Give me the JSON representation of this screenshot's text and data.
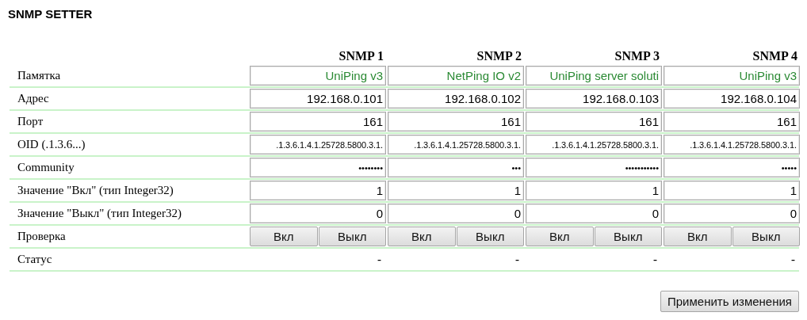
{
  "title": "SNMP SETTER",
  "columns": [
    "SNMP 1",
    "SNMP 2",
    "SNMP 3",
    "SNMP 4"
  ],
  "rows": [
    {
      "label": "Памятка",
      "kind": "memo",
      "values": [
        "UniPing v3",
        "NetPing IO v2",
        "UniPing server soluti",
        "UniPing v3"
      ]
    },
    {
      "label": "Адрес",
      "kind": "input",
      "values": [
        "192.168.0.101",
        "192.168.0.102",
        "192.168.0.103",
        "192.168.0.104"
      ]
    },
    {
      "label": "Порт",
      "kind": "input",
      "values": [
        "161",
        "161",
        "161",
        "161"
      ]
    },
    {
      "label": "OID (.1.3.6...)",
      "kind": "oid",
      "values": [
        ".1.3.6.1.4.1.25728.5800.3.1.",
        ".1.3.6.1.4.1.25728.5800.3.1.",
        ".1.3.6.1.4.1.25728.5800.3.1.",
        ".1.3.6.1.4.1.25728.5800.3.1."
      ]
    },
    {
      "label": "Community",
      "kind": "secret",
      "values": [
        "••••••••",
        "•••",
        "•••••••••••",
        "•••••"
      ]
    },
    {
      "label": "Значение \"Вкл\" (тип Integer32)",
      "kind": "input",
      "values": [
        "1",
        "1",
        "1",
        "1"
      ]
    },
    {
      "label": "Значение \"Выкл\" (тип Integer32)",
      "kind": "input",
      "values": [
        "0",
        "0",
        "0",
        "0"
      ]
    },
    {
      "label": "Проверка",
      "kind": "buttons",
      "values": [
        [
          "Вкл",
          "Выкл"
        ],
        [
          "Вкл",
          "Выкл"
        ],
        [
          "Вкл",
          "Выкл"
        ],
        [
          "Вкл",
          "Выкл"
        ]
      ]
    },
    {
      "label": "Статус",
      "kind": "status",
      "values": [
        "-",
        "-",
        "-",
        "-"
      ]
    }
  ],
  "apply_button": "Применить изменения"
}
